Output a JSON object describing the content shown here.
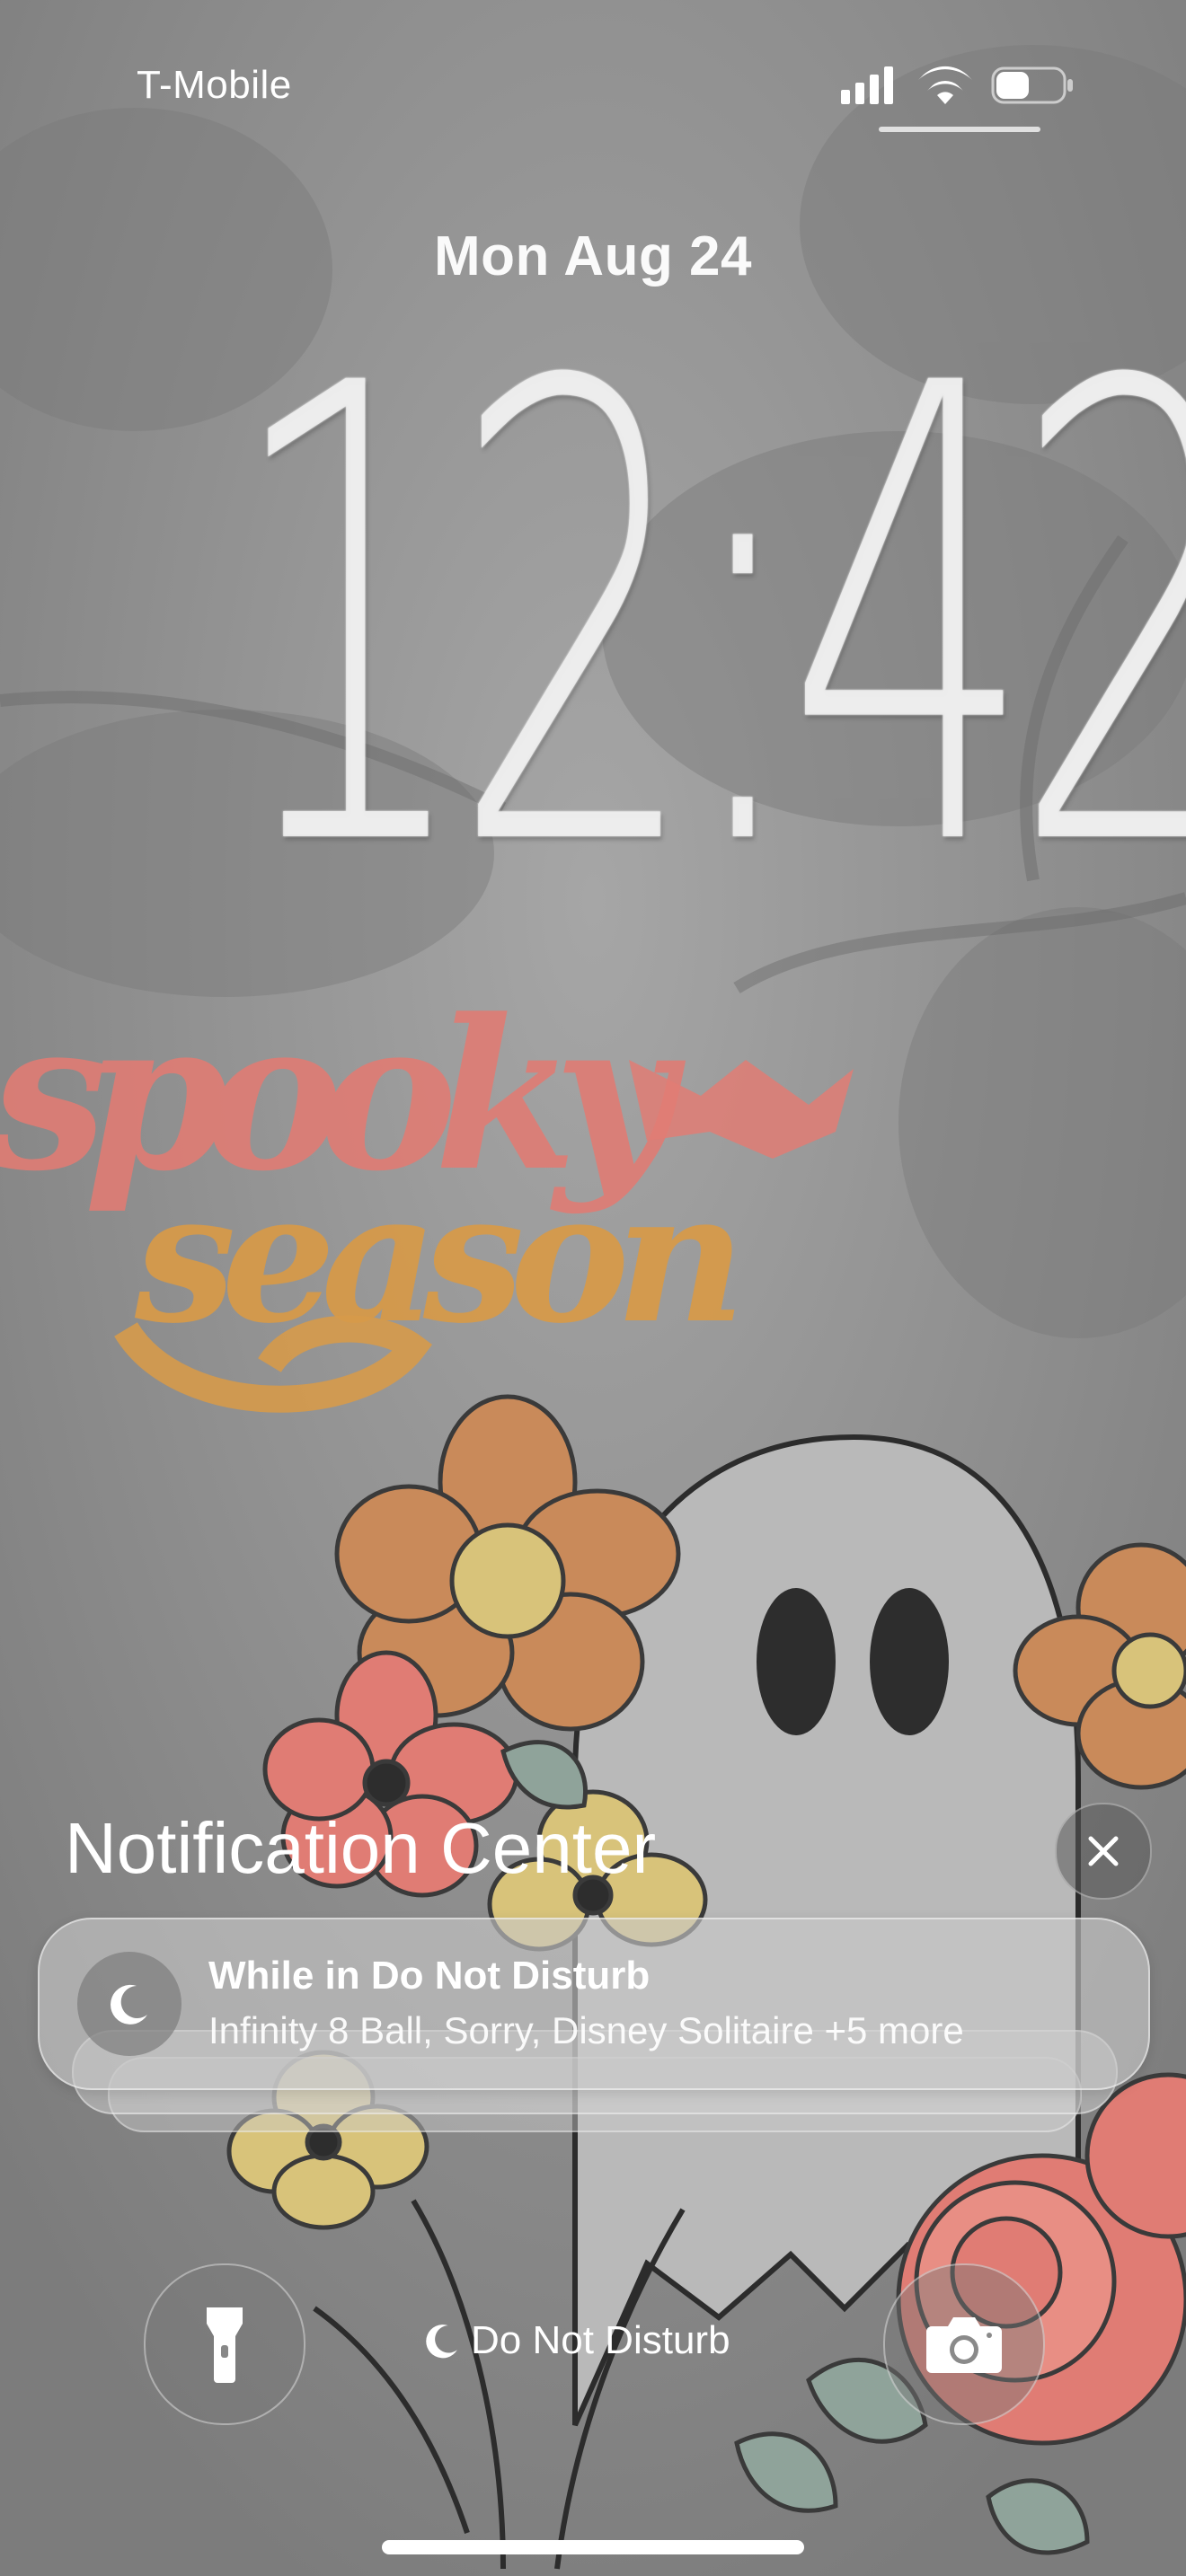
{
  "status_bar": {
    "carrier": "T-Mobile",
    "signal_icon": "cellular-signal-icon",
    "wifi_icon": "wifi-icon",
    "battery_icon": "battery-icon",
    "battery_level": 0.5
  },
  "lock_screen": {
    "date": "Mon Aug 24",
    "time": "12:42"
  },
  "wallpaper": {
    "text_line1": "spooky",
    "text_line2": "season",
    "color_spooky": "#e07c74",
    "color_season": "#d69a4a"
  },
  "notification_center": {
    "title": "Notification Center",
    "close_icon": "close-icon",
    "notification": {
      "icon": "moon-icon",
      "title": "While in Do Not Disturb",
      "body": "Infinity 8 Ball, Sorry, Disney Solitaire +5 more"
    }
  },
  "bottom_controls": {
    "flashlight_icon": "flashlight-icon",
    "camera_icon": "camera-icon",
    "focus_label": "Do Not Disturb",
    "focus_icon": "moon-icon"
  }
}
